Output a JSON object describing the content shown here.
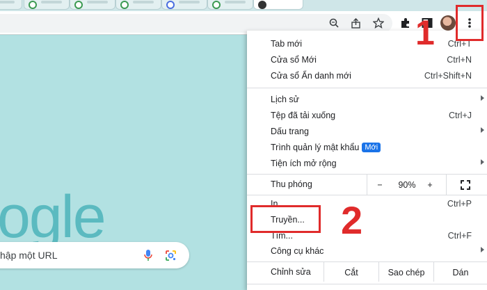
{
  "annotations": {
    "step1": "1",
    "step2": "2"
  },
  "page": {
    "logo_text": "ogle",
    "search_placeholder": "hập một URL"
  },
  "menu": {
    "new_tab": {
      "label": "Tab mới",
      "shortcut": "Ctrl+T"
    },
    "new_window": {
      "label": "Cửa sổ Mới",
      "shortcut": "Ctrl+N"
    },
    "incognito": {
      "label": "Cửa sổ Ẩn danh mới",
      "shortcut": "Ctrl+Shift+N"
    },
    "history": {
      "label": "Lịch sử"
    },
    "downloads": {
      "label": "Tệp đã tải xuống",
      "shortcut": "Ctrl+J"
    },
    "bookmarks": {
      "label": "Dấu trang"
    },
    "passwords": {
      "label": "Trình quản lý mật khẩu",
      "badge": "Mới"
    },
    "extensions": {
      "label": "Tiện ích mở rộng"
    },
    "zoom": {
      "label": "Thu phóng",
      "minus": "−",
      "value": "90%",
      "plus": "+"
    },
    "print": {
      "label": "In...",
      "shortcut": "Ctrl+P"
    },
    "cast": {
      "label": "Truyền..."
    },
    "find": {
      "label": "Tìm...",
      "shortcut": "Ctrl+F"
    },
    "more_tools": {
      "label": "Công cụ khác"
    },
    "edit": {
      "label": "Chỉnh sửa",
      "cut": "Cắt",
      "copy": "Sao chép",
      "paste": "Dán"
    }
  },
  "colors": {
    "annotation_red": "#e02b2b",
    "badge_blue": "#1a73e8",
    "page_bg": "#b2e1e2"
  }
}
